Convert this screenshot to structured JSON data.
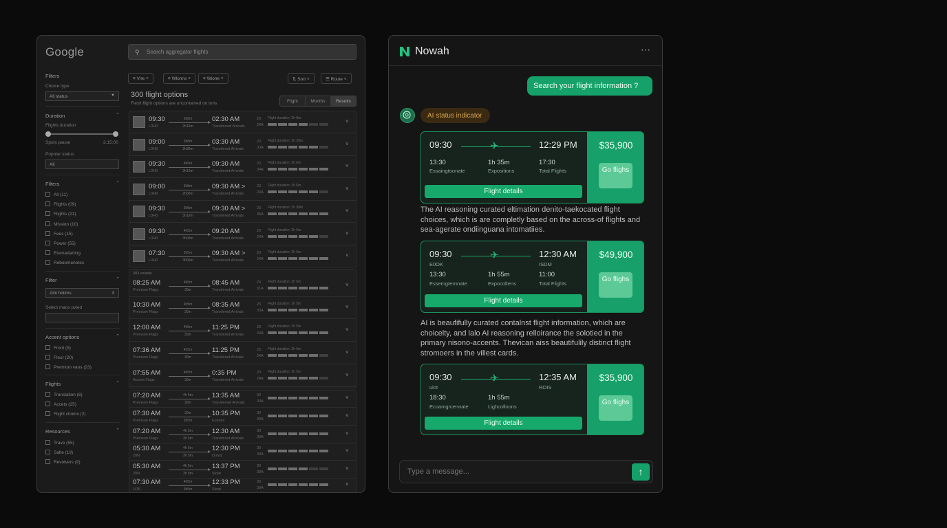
{
  "google": {
    "logo": "Google",
    "search_placeholder": "Search aggregator flights",
    "sidebar": {
      "filters_title": "Filters",
      "choice_type_label": "Choice type",
      "choice_type_value": "All status",
      "duration_title": "Duration",
      "flights_duration_label": "Flights duration",
      "range_min": "Spots pause",
      "range_max": "3.15:00",
      "popular_status_label": "Popular status",
      "popular_status_value": "All",
      "filters2_title": "Filters",
      "checks1": [
        "All (11)",
        "Flights (09)",
        "Flights (21)",
        "Mission (10)",
        "Fees (15)",
        "Power (55)",
        "Eremadarting",
        "Reboomenotes"
      ],
      "filter_title": "Filter",
      "filter_value": "Alni hotims",
      "filter_count": "3",
      "select_label": "Select maos pvied",
      "accent_title": "Accent options",
      "checks2": [
        "Front (9)",
        "Fleur (20)",
        "Premiom vans (23)"
      ],
      "flights_title": "Flights",
      "checks3": [
        "Translation (6)",
        "Accets (25)",
        "Flight chomx (2)"
      ],
      "resources_title": "Resources",
      "checks4": [
        "Trave (55)",
        "Salte (19)",
        "Revolvers (9)"
      ]
    },
    "toolbar": [
      "Vne",
      "Wlonns",
      "Wione",
      "Sort",
      "Route"
    ],
    "options_title": "300 flight options",
    "options_subtitle": "Flexit flight options are uncontained on tons",
    "segments": [
      "Flight",
      "Months",
      "Results"
    ],
    "group2_label": "303 celzals",
    "rows_a": [
      {
        "dep": "09:30",
        "dep_sub": "L0H0",
        "dur": "3h8m",
        "dur2": "2h10m",
        "arr": "02:30 AM",
        "arr_sub": "Transferred Arrivals",
        "n1": "23",
        "n2": "24A",
        "bl": "Flight duration: 2h 8m",
        "bars": 4
      },
      {
        "dep": "09:00",
        "dep_sub": "L0H0",
        "dur": "3h8m",
        "dur2": "2h30m",
        "arr": "03:30 AM",
        "arr_sub": "Transfered Arrivals",
        "n1": "23",
        "n2": "33A",
        "bl": "Flight duration: 2h 28m",
        "bars": 5
      },
      {
        "dep": "09:30",
        "dep_sub": "L0H0",
        "dur": "4h0m",
        "dur2": "3h10m",
        "arr": "09:30 AM",
        "arr_sub": "Transfered Arrivals",
        "n1": "23",
        "n2": "34A",
        "bl": "Flight duration: 2h 6m",
        "bars": 6
      },
      {
        "dep": "09:00",
        "dep_sub": "L0H0",
        "dur": "3h8m",
        "dur2": "2h00m",
        "arr": "09:30 AM >",
        "arr_sub": "Transfered Arrivals",
        "n1": "23",
        "n2": "24A",
        "bl": "Flight duration: 2h 6m",
        "bars": 5
      },
      {
        "dep": "09:30",
        "dep_sub": "L0H0",
        "dur": "3h8m",
        "dur2": "3h10m",
        "arr": "09:30 AM >",
        "arr_sub": "Transfered Arrivals",
        "n1": "23",
        "n2": "35A",
        "bl": "Flight duration: 2h 58m",
        "bars": 6
      },
      {
        "dep": "09:30",
        "dep_sub": "L0H0",
        "dur": "4h5m",
        "dur2": "3h00m",
        "arr": "09:20 AM",
        "arr_sub": "Transfered Arrivals",
        "n1": "23",
        "n2": "24A",
        "bl": "Flight duration: 2h 5m",
        "bars": 5
      },
      {
        "dep": "07:30",
        "dep_sub": "L0H0",
        "dur": "3h5m",
        "dur2": "3h00m",
        "arr": "09:30 AM >",
        "arr_sub": "Transfered Arrivals",
        "n1": "23",
        "n2": "24A",
        "bl": "Flight duration: 2h 6m",
        "bars": 6
      }
    ],
    "rows_b": [
      {
        "dep": "08:25 AM",
        "dep_sub": "Premium Flags",
        "dur": "4h0m",
        "dur2": "30m",
        "arr": "08:45 AM",
        "arr_sub": "Transfered Arrivals",
        "n1": "23",
        "n2": "31A",
        "bl": "Flight duration: 2h 6m",
        "bars": 6
      },
      {
        "dep": "10:30 AM",
        "dep_sub": "Premium Flags",
        "dur": "4h5m",
        "dur2": "30m",
        "arr": "08:35 AM",
        "arr_sub": "Transfered Arrivals",
        "n1": "23",
        "n2": "33A",
        "bl": "Flight duration: 2h 5m",
        "bars": 6
      },
      {
        "dep": "12:00 AM",
        "dep_sub": "Premium Flags",
        "dur": "4h5m",
        "dur2": "30m",
        "arr": "11:25 PM",
        "arr_sub": "Transfered Arrivals",
        "n1": "23",
        "n2": "34A",
        "bl": "Flight duration: 2h 5m",
        "bars": 6
      },
      {
        "dep": "07:36 AM",
        "dep_sub": "Premium Flags",
        "dur": "4h5m",
        "dur2": "30m",
        "arr": "11:25 PM",
        "arr_sub": "Transfered Arrivals",
        "n1": "23",
        "n2": "24A",
        "bl": "Flight duration: 2h 6m",
        "bars": 5
      },
      {
        "dep": "07:55 AM",
        "dep_sub": "Accent Flags",
        "dur": "4h5m",
        "dur2": "30m",
        "arr": "0:35 PM",
        "arr_sub": "Transfered Arrivals",
        "n1": "23",
        "n2": "24A",
        "bl": "Flight duration: 2h 5m",
        "bars": 5
      }
    ],
    "rows_c": [
      {
        "dep": "07:20 AM",
        "dep_sub": "Premium Flags",
        "dur": "4h 5m",
        "dur2": "30m",
        "arr": "13:35 AM",
        "arr_sub": "Transferred Arrivals",
        "n1": "30",
        "n2": "30A",
        "bars": 7
      },
      {
        "dep": "07:30 AM",
        "dep_sub": "Premium Flags",
        "dur": "30m",
        "dur2": "3h5m",
        "arr": "10:35 PM",
        "arr_sub": "Ecenes",
        "n1": "30",
        "n2": "30A",
        "bars": 6
      },
      {
        "dep": "07:20 AM",
        "dep_sub": "Premium Flags",
        "dur": "4h 5m",
        "dur2": "3h 5m",
        "arr": "12:30 AM",
        "arr_sub": "Transfered Arrivals",
        "n1": "30",
        "n2": "30A",
        "bars": 7
      },
      {
        "dep": "05:30 AM",
        "dep_sub": "20N",
        "dur": "4h 5m",
        "dur2": "3h 5m",
        "arr": "12:30 PM",
        "arr_sub": "Dunst",
        "n1": "30",
        "n2": "30A",
        "bars": 6
      },
      {
        "dep": "05:30 AM",
        "dep_sub": "20N",
        "dur": "4h 5m",
        "dur2": "3h 5m",
        "arr": "13:37 PM",
        "arr_sub": "Stoat",
        "n1": "30",
        "n2": "30A",
        "bars": 4
      },
      {
        "dep": "07:30 AM",
        "dep_sub": "LOS",
        "dur": "4h5m",
        "dur2": "3h5m",
        "arr": "12:33 PM",
        "arr_sub": "Stoat",
        "n1": "30",
        "n2": "30A",
        "bars": 6
      }
    ]
  },
  "nowah": {
    "title": "Nowah",
    "menu_icon": "more-horizontal-icon",
    "user_message": "Search your flight information ?",
    "status": "AI status indicator",
    "cards": [
      {
        "dep": "09:30",
        "arr": "12:29 PM",
        "dep_sub": "",
        "arr_sub": "",
        "meta1": "13:30",
        "meta1_sub": "Essaingtoonate",
        "meta2": "1h 35m",
        "meta2_sub": "Expositions",
        "meta3": "17:30",
        "meta3_sub": "Total Flights",
        "details": "Flight details",
        "price": "$35,900",
        "go": "Go flighs"
      },
      {
        "dep": "09:30",
        "arr": "12:30 AM",
        "dep_sub": "E0OK",
        "arr_sub": "ISDM",
        "meta1": "13:30",
        "meta1_sub": "Essemgternnate",
        "meta2": "1h 55m",
        "meta2_sub": "Expocoltens",
        "meta3": "11:00",
        "meta3_sub": "Total Flights",
        "details": "Flight details",
        "price": "$49,900",
        "go": "Go flighs"
      },
      {
        "dep": "09:30",
        "arr": "12:35 AM",
        "dep_sub": "ulot",
        "arr_sub": "ROIS",
        "meta1": "18:30",
        "meta1_sub": "Ecoamgrcennate",
        "meta2": "1h 55m",
        "meta2_sub": "Lighcolloons",
        "meta3": "",
        "meta3_sub": "",
        "details": "Flight details",
        "price": "$35,900",
        "go": "Go flighs"
      }
    ],
    "para1": "The AI reasoning curated eltimation denito-taekocated flight choices, which is are completly based on the across-of flights and sea-agerate ondiinguana intomatiies.",
    "para2": "AI is beaufifully curated contalnst flight information, which are choicelty, and lalo AI reasoning relloirance the solotied in the primary nisono-accents. Thevican aiss beautifulily distinct flight stromoers in the villest cards.",
    "input_placeholder": "Type a message...",
    "colors": {
      "accent": "#16a06a",
      "status_text": "#d8a34c"
    }
  }
}
